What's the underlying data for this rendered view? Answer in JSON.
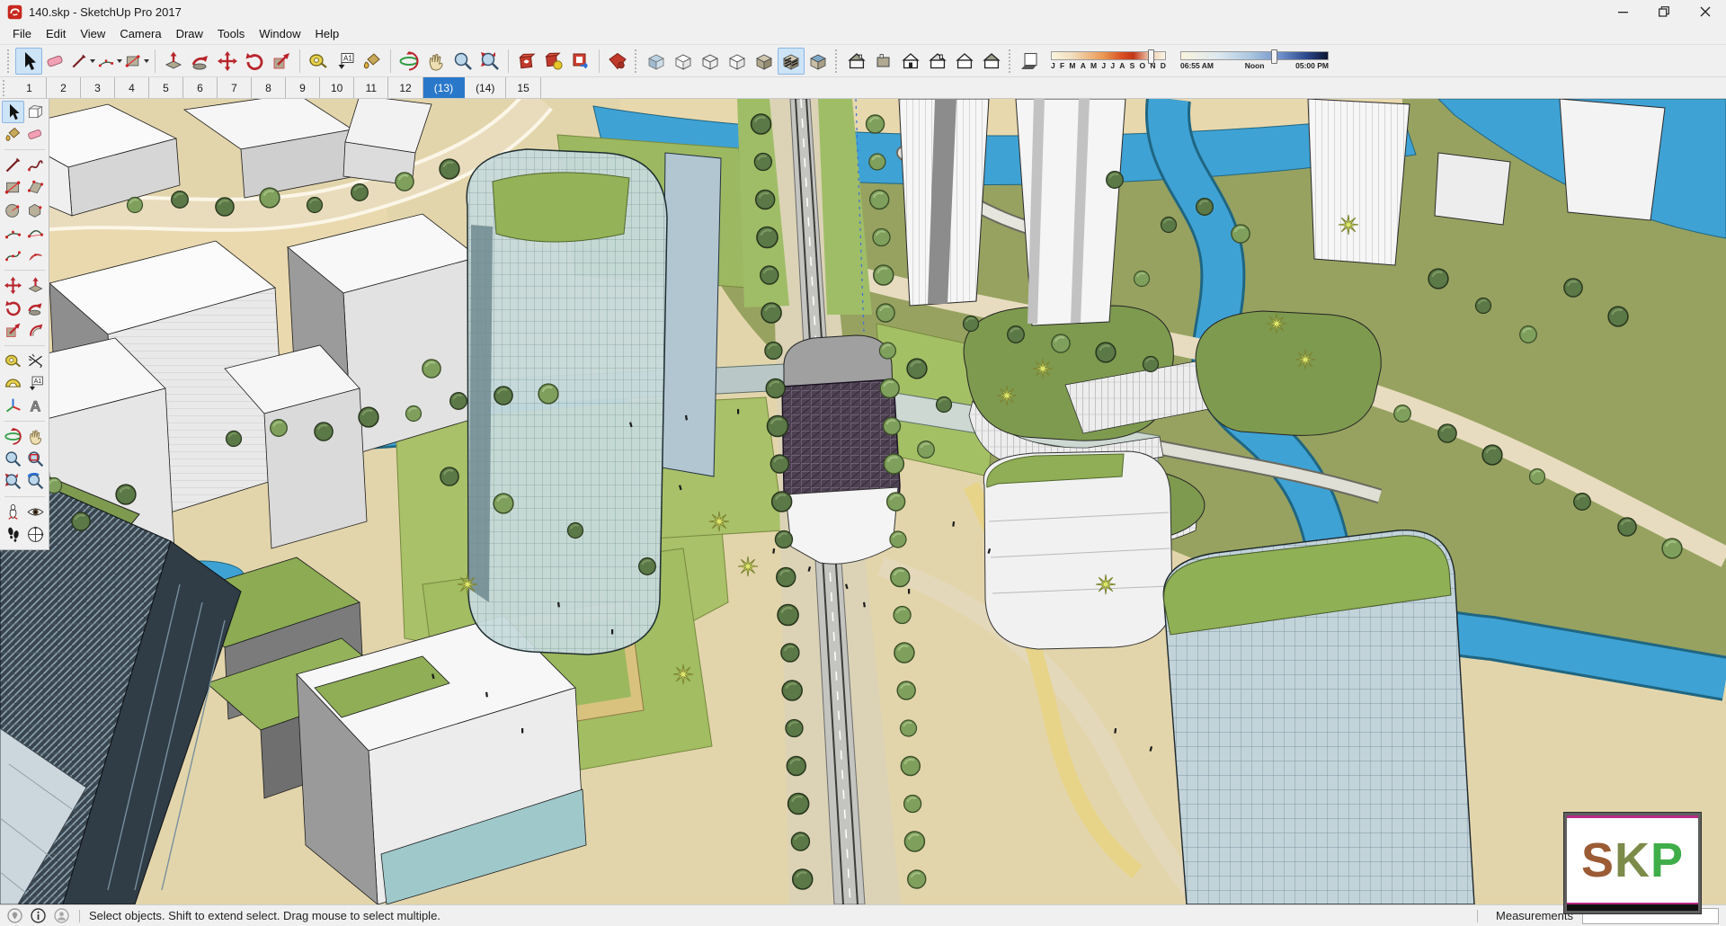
{
  "window": {
    "title": "140.skp - SketchUp Pro 2017",
    "controls": [
      "minimize",
      "maximize",
      "close"
    ]
  },
  "menu": {
    "items": [
      "File",
      "Edit",
      "View",
      "Camera",
      "Draw",
      "Tools",
      "Window",
      "Help"
    ]
  },
  "toolbar": {
    "groups": [
      {
        "name": "principal",
        "tools": [
          {
            "name": "select",
            "selected": true
          },
          {
            "name": "eraser"
          },
          {
            "name": "line",
            "dropdown": true
          },
          {
            "name": "arc",
            "dropdown": true
          },
          {
            "name": "rectangle",
            "dropdown": true
          }
        ]
      },
      {
        "name": "edit",
        "tools": [
          {
            "name": "push-pull"
          },
          {
            "name": "follow-me"
          },
          {
            "name": "move"
          },
          {
            "name": "rotate"
          },
          {
            "name": "scale"
          }
        ]
      },
      {
        "name": "construction",
        "tools": [
          {
            "name": "tape-measure"
          },
          {
            "name": "text"
          },
          {
            "name": "paint-bucket"
          }
        ]
      },
      {
        "name": "camera",
        "tools": [
          {
            "name": "orbit"
          },
          {
            "name": "pan"
          },
          {
            "name": "zoom"
          },
          {
            "name": "zoom-extents"
          }
        ]
      },
      {
        "name": "warehouse",
        "tools": [
          {
            "name": "3d-warehouse"
          },
          {
            "name": "share-model"
          },
          {
            "name": "extension-warehouse"
          }
        ]
      },
      {
        "name": "layout",
        "tools": [
          {
            "name": "send-to-layout"
          }
        ]
      },
      {
        "name": "styles",
        "tools": [
          {
            "name": "x-ray"
          },
          {
            "name": "back-edges"
          },
          {
            "name": "wireframe"
          },
          {
            "name": "hidden-line"
          },
          {
            "name": "shaded"
          },
          {
            "name": "shaded-with-textures",
            "selected": true
          },
          {
            "name": "monochrome"
          }
        ]
      },
      {
        "name": "views",
        "tools": [
          {
            "name": "iso"
          },
          {
            "name": "top"
          },
          {
            "name": "front"
          },
          {
            "name": "back"
          },
          {
            "name": "left"
          },
          {
            "name": "right"
          }
        ]
      }
    ],
    "shadows": {
      "toggle": "shadow-toggle",
      "date": {
        "months": [
          "J",
          "F",
          "M",
          "A",
          "M",
          "J",
          "J",
          "A",
          "S",
          "O",
          "N",
          "D"
        ],
        "thumb_pct": 87
      },
      "time": {
        "labels": [
          "06:55 AM",
          "Noon",
          "05:00 PM"
        ],
        "thumb_pct": 63
      }
    },
    "icon_glyphs": {
      "text_tool": "A1",
      "three_d_text": "A"
    }
  },
  "scene_tabs": {
    "tabs": [
      "1",
      "2",
      "3",
      "4",
      "5",
      "6",
      "7",
      "8",
      "9",
      "10",
      "11",
      "12",
      "(13)",
      "(14)",
      "15"
    ],
    "selected": "(13)"
  },
  "tool_palette": {
    "rows": [
      [
        "select",
        "make-component"
      ],
      [
        "paint-bucket",
        "eraser"
      ],
      "sep",
      [
        "line",
        "freehand"
      ],
      [
        "rectangle",
        "rotated-rectangle"
      ],
      [
        "circle",
        "polygon"
      ],
      [
        "arc",
        "2-point-arc"
      ],
      [
        "3-point-arc",
        "pie"
      ],
      "sep",
      [
        "move",
        "push-pull"
      ],
      [
        "rotate",
        "follow-me"
      ],
      [
        "scale",
        "offset"
      ],
      "sep",
      [
        "tape-measure",
        "dimension"
      ],
      [
        "protractor",
        "text"
      ],
      [
        "axes",
        "3d-text"
      ],
      "sep",
      [
        "orbit",
        "pan"
      ],
      [
        "zoom",
        "zoom-window"
      ],
      [
        "zoom-extents",
        "previous-view"
      ],
      "sep",
      [
        "position-camera",
        "look-around"
      ],
      [
        "walk",
        "section-plane"
      ]
    ],
    "selected_tool": "select"
  },
  "viewport": {
    "scene_palette": {
      "ground_tan": "#e3d5ab",
      "olive_ground": "#97a260",
      "lawn_green": "#a9c168",
      "water_blue": "#3fa2d4",
      "roof_green": "#7e9a4f",
      "glass_teal": "#c7dadb",
      "station_purple": "#4e4152",
      "building_white": "#f7f7f7",
      "dark_glass": "#39454f",
      "yellow_path": "#e7d488"
    },
    "watermark": {
      "letters": [
        {
          "char": "S",
          "color": "#9a5b35"
        },
        {
          "char": "K",
          "color": "#7c8b49"
        },
        {
          "char": "P",
          "color": "#3fae49"
        }
      ]
    }
  },
  "status_bar": {
    "icons": [
      "geolocation-icon",
      "help-icon",
      "user-icon"
    ],
    "message": "Select objects. Shift to extend select. Drag mouse to select multiple.",
    "measurements_label": "Measurements",
    "measurements_value": ""
  }
}
